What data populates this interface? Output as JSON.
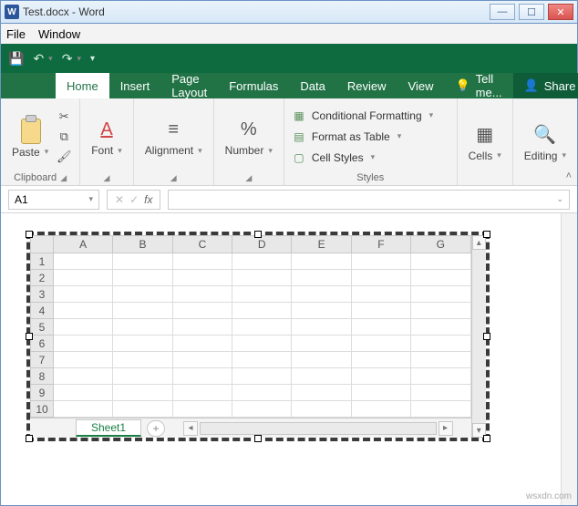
{
  "window": {
    "title": "Test.docx - Word",
    "app_icon_letter": "W"
  },
  "menubar": {
    "file": "File",
    "window": "Window"
  },
  "ribbon": {
    "tabs": {
      "home": "Home",
      "insert": "Insert",
      "pagelayout": "Page Layout",
      "formulas": "Formulas",
      "data": "Data",
      "review": "Review",
      "view": "View"
    },
    "tellme": "Tell me...",
    "share": "Share",
    "groups": {
      "clipboard": {
        "paste": "Paste",
        "label": "Clipboard"
      },
      "font": {
        "btn": "Font",
        "label": "Font"
      },
      "alignment": {
        "btn": "Alignment",
        "label": ""
      },
      "number": {
        "btn": "Number",
        "label": ""
      },
      "styles": {
        "cond_fmt": "Conditional Formatting",
        "as_table": "Format as Table",
        "cell_styles": "Cell Styles",
        "label": "Styles"
      },
      "cells": {
        "btn": "Cells"
      },
      "editing": {
        "btn": "Editing"
      }
    }
  },
  "formula_bar": {
    "namebox": "A1",
    "cancel": "✕",
    "enter": "✓",
    "fx": "fx",
    "value": ""
  },
  "sheet": {
    "columns": [
      "A",
      "B",
      "C",
      "D",
      "E",
      "F",
      "G"
    ],
    "rows": [
      "1",
      "2",
      "3",
      "4",
      "5",
      "6",
      "7",
      "8",
      "9",
      "10"
    ],
    "tab": "Sheet1",
    "active_cell": "A1"
  },
  "watermark": "wsxdn.com"
}
